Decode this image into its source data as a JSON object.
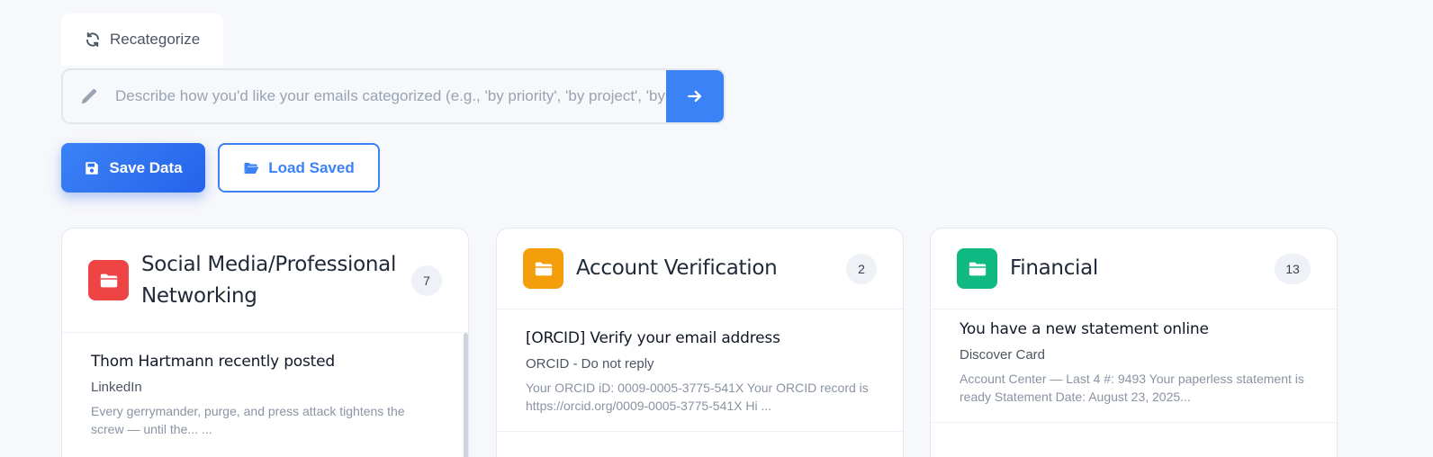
{
  "toolbar": {
    "recategorize_label": "Recategorize",
    "prompt_placeholder": "Describe how you'd like your emails categorized (e.g., 'by priority', 'by project', 'by sender type')",
    "save_label": "Save Data",
    "load_label": "Load Saved"
  },
  "colors": {
    "accent": "#3b82f6",
    "social": "#ef4444",
    "account": "#f59e0b",
    "financial": "#10b981"
  },
  "categories": [
    {
      "title": "Social Media/Professional Networking",
      "title_line1": "Social Media/Professional",
      "title_line2": "Networking",
      "count": "7",
      "icon": "folder-icon",
      "emails": [
        {
          "subject": "Thom Hartmann recently posted",
          "from": "LinkedIn",
          "snippet": "Every gerrymander, purge, and press attack tightens the screw — until the...                  ..."
        }
      ]
    },
    {
      "title": "Account Verification",
      "count": "2",
      "icon": "folder-icon",
      "emails": [
        {
          "subject": "[ORCID] Verify your email address",
          "from": "ORCID - Do not reply",
          "snippet": "Your ORCID iD: 0009-0005-3775-541X Your ORCID record is https://orcid.org/0009-0005-3775-541X Hi ..."
        }
      ]
    },
    {
      "title": "Financial",
      "count": "13",
      "icon": "folder-icon",
      "emails": [
        {
          "subject": "You have a new statement online",
          "from": "Discover Card",
          "snippet": "Account Center — Last 4 #: 9493 Your paperless statement is ready Statement Date: August 23, 2025..."
        }
      ]
    }
  ]
}
